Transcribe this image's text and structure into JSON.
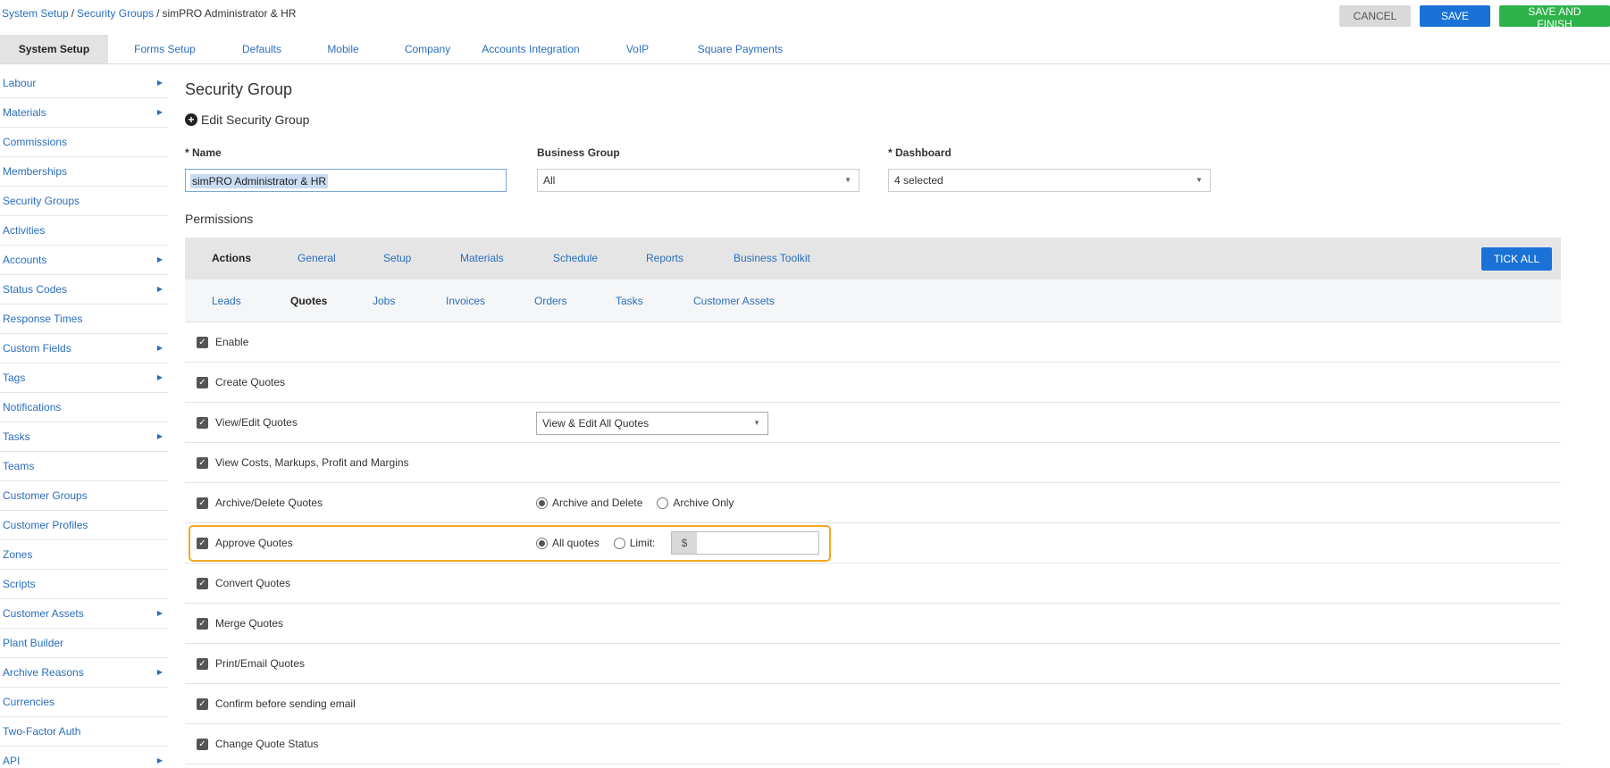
{
  "breadcrumb": {
    "items": [
      "System Setup",
      "Security Groups"
    ],
    "current": "simPRO Administrator & HR"
  },
  "header": {
    "cancel_label": "CANCEL",
    "save_label": "SAVE",
    "finish_label": "SAVE AND FINISH"
  },
  "topnav": {
    "tabs": [
      "System Setup",
      "Forms Setup",
      "Defaults",
      "Mobile",
      "Company",
      "Accounts Integration",
      "VoIP",
      "Square Payments"
    ],
    "active": "System Setup"
  },
  "sidebar": {
    "items": [
      {
        "label": "Labour",
        "has_arrow": true
      },
      {
        "label": "Materials",
        "has_arrow": true
      },
      {
        "label": "Commissions",
        "has_arrow": false
      },
      {
        "label": "Memberships",
        "has_arrow": false
      },
      {
        "label": "Security Groups",
        "has_arrow": false
      },
      {
        "label": "Activities",
        "has_arrow": false
      },
      {
        "label": "Accounts",
        "has_arrow": true
      },
      {
        "label": "Status Codes",
        "has_arrow": true
      },
      {
        "label": "Response Times",
        "has_arrow": false
      },
      {
        "label": "Custom Fields",
        "has_arrow": true
      },
      {
        "label": "Tags",
        "has_arrow": true
      },
      {
        "label": "Notifications",
        "has_arrow": false
      },
      {
        "label": "Tasks",
        "has_arrow": true
      },
      {
        "label": "Teams",
        "has_arrow": false
      },
      {
        "label": "Customer Groups",
        "has_arrow": false
      },
      {
        "label": "Customer Profiles",
        "has_arrow": false
      },
      {
        "label": "Zones",
        "has_arrow": false
      },
      {
        "label": "Scripts",
        "has_arrow": false
      },
      {
        "label": "Customer Assets",
        "has_arrow": true
      },
      {
        "label": "Plant Builder",
        "has_arrow": false
      },
      {
        "label": "Archive Reasons",
        "has_arrow": true
      },
      {
        "label": "Currencies",
        "has_arrow": false
      },
      {
        "label": "Two-Factor Auth",
        "has_arrow": false
      },
      {
        "label": "API",
        "has_arrow": true
      }
    ]
  },
  "main": {
    "title": "Security Group",
    "subtitle": "Edit Security Group",
    "name_label": "Name",
    "name_value": "simPRO Administrator & HR",
    "business_group_label": "Business Group",
    "business_group_value": "All",
    "dashboard_label": "Dashboard",
    "dashboard_value": "4 selected",
    "permissions_title": "Permissions",
    "required_marker": "*"
  },
  "category_tabs": {
    "items": [
      "Actions",
      "General",
      "Setup",
      "Materials",
      "Schedule",
      "Reports",
      "Business Toolkit"
    ],
    "active": "Actions",
    "tick_all_label": "TICK ALL"
  },
  "sub_tabs": {
    "items": [
      "Leads",
      "Quotes",
      "Jobs",
      "Invoices",
      "Orders",
      "Tasks",
      "Customer Assets"
    ],
    "active": "Quotes"
  },
  "permissions": {
    "checkmark": "✓",
    "rows": [
      {
        "label": "Enable",
        "checked": true
      },
      {
        "label": "Create Quotes",
        "checked": true
      },
      {
        "label": "View/Edit Quotes",
        "checked": true,
        "select": "View & Edit All Quotes"
      },
      {
        "label": "View Costs, Markups, Profit and Margins",
        "checked": true
      },
      {
        "label": "Archive/Delete Quotes",
        "checked": true,
        "radios": [
          {
            "label": "Archive and Delete",
            "on": true
          },
          {
            "label": "Archive Only",
            "on": false
          }
        ]
      },
      {
        "label": "Approve Quotes",
        "checked": true,
        "highlighted": true,
        "radios": [
          {
            "label": "All quotes",
            "on": true
          },
          {
            "label": "Limit:",
            "on": false
          }
        ],
        "limit_currency": "$",
        "limit_value": ""
      },
      {
        "label": "Convert Quotes",
        "checked": true
      },
      {
        "label": "Merge Quotes",
        "checked": true
      },
      {
        "label": "Print/Email Quotes",
        "checked": true
      },
      {
        "label": "Confirm before sending email",
        "checked": true
      },
      {
        "label": "Change Quote Status",
        "checked": true
      }
    ]
  },
  "colors": {
    "link": "#2a6ebb",
    "primary": "#1a72d6",
    "success": "#2db34a",
    "highlight": "#f5a623"
  }
}
